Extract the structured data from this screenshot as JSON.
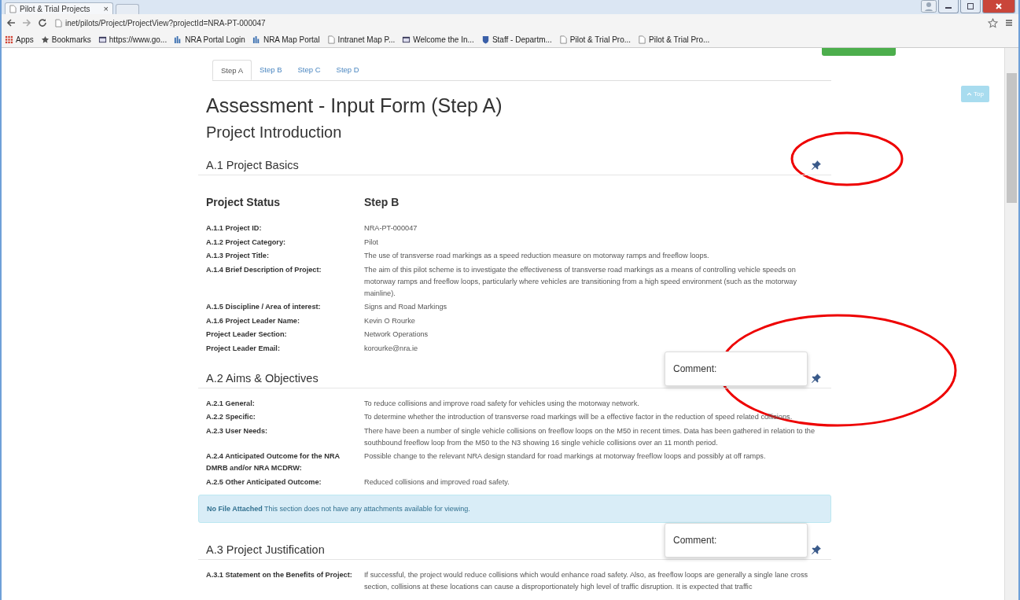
{
  "browser": {
    "tab": {
      "title": "Pilot & Trial Projects",
      "close": "×"
    },
    "address": {
      "url": "inet/pilots/Project/ProjectView?projectId=NRA-PT-000047"
    },
    "bookmarks": [
      {
        "kind": "apps",
        "label": "Apps"
      },
      {
        "kind": "star",
        "label": "Bookmarks"
      },
      {
        "kind": "site",
        "label": "https://www.go..."
      },
      {
        "kind": "portal",
        "label": "NRA Portal Login"
      },
      {
        "kind": "portal",
        "label": "NRA Map Portal"
      },
      {
        "kind": "page",
        "label": "Intranet Map P..."
      },
      {
        "kind": "site",
        "label": "Welcome the In..."
      },
      {
        "kind": "shield",
        "label": "Staff - Departm..."
      },
      {
        "kind": "page",
        "label": "Pilot & Trial Pro..."
      },
      {
        "kind": "page",
        "label": "Pilot & Trial Pro..."
      }
    ]
  },
  "tabs": [
    {
      "label": "Step A",
      "selected": true
    },
    {
      "label": "Step B",
      "selected": false
    },
    {
      "label": "Step C",
      "selected": false
    },
    {
      "label": "Step D",
      "selected": false
    }
  ],
  "top_button": "Top",
  "title": "Assessment - Input Form (Step A)",
  "subtitle": "Project Introduction",
  "sections": [
    {
      "title": "A.1 Project Basics",
      "status": {
        "label": "Project Status",
        "value": "Step B"
      },
      "rows": [
        {
          "label": "A.1.1 Project ID:",
          "value": "NRA-PT-000047"
        },
        {
          "label": "A.1.2 Project Category:",
          "value": "Pilot"
        },
        {
          "label": "A.1.3 Project Title:",
          "value": "The use of transverse road markings as a speed reduction measure on motorway ramps and freeflow loops."
        },
        {
          "label": "A.1.4 Brief Description of Project:",
          "value": "The aim of this pilot scheme is to investigate the effectiveness of transverse road markings as a means of controlling vehicle speeds on motorway ramps and freeflow loops, particularly where vehicles are transitioning from a high speed environment (such as the motorway mainline)."
        },
        {
          "label": "A.1.5 Discipline / Area of interest:",
          "value": "Signs and Road Markings"
        },
        {
          "label": "A.1.6 Project Leader Name:",
          "value": "Kevin O Rourke"
        },
        {
          "label": "Project Leader Section:",
          "value": "Network Operations"
        },
        {
          "label": "Project Leader Email:",
          "value": "korourke@nra.ie"
        }
      ]
    },
    {
      "title": "A.2 Aims & Objectives",
      "comment": "Comment:",
      "rows": [
        {
          "label": "A.2.1 General:",
          "value": "To reduce collisions and improve road safety for vehicles using the motorway network."
        },
        {
          "label": "A.2.2 Specific:",
          "value": "To determine whether the introduction of transverse road markings will be a effective factor in the reduction of speed related collisions."
        },
        {
          "label": "A.2.3 User Needs:",
          "value": "There have been a number of single vehicle collisions on freeflow loops on the M50 in recent times. Data has been gathered in relation to the southbound freeflow loop from the M50 to the N3 showing 16 single vehicle collisions over an 11 month period."
        },
        {
          "label": "A.2.4 Anticipated Outcome for the NRA DMRB and/or NRA MCDRW:",
          "value": "Possible change to the relevant NRA design standard for road markings at motorway freeflow loops and possibly at off ramps."
        },
        {
          "label": "A.2.5 Other Anticipated Outcome:",
          "value": "Reduced collisions and improved road safety."
        }
      ],
      "alert": "**No File Attached** This section does not have any attachments available for viewing."
    },
    {
      "title": "A.3 Project Justification",
      "comment": "Comment:",
      "rows": [
        {
          "label": "A.3.1 Statement on the Benefits of Project:",
          "value": "If successful, the project would reduce collisions which would enhance road safety. Also, as freeflow loops are generally a single lane cross section, collisions at these locations can cause a disproportionately high level of traffic disruption. It is expected that traffic"
        }
      ]
    }
  ]
}
